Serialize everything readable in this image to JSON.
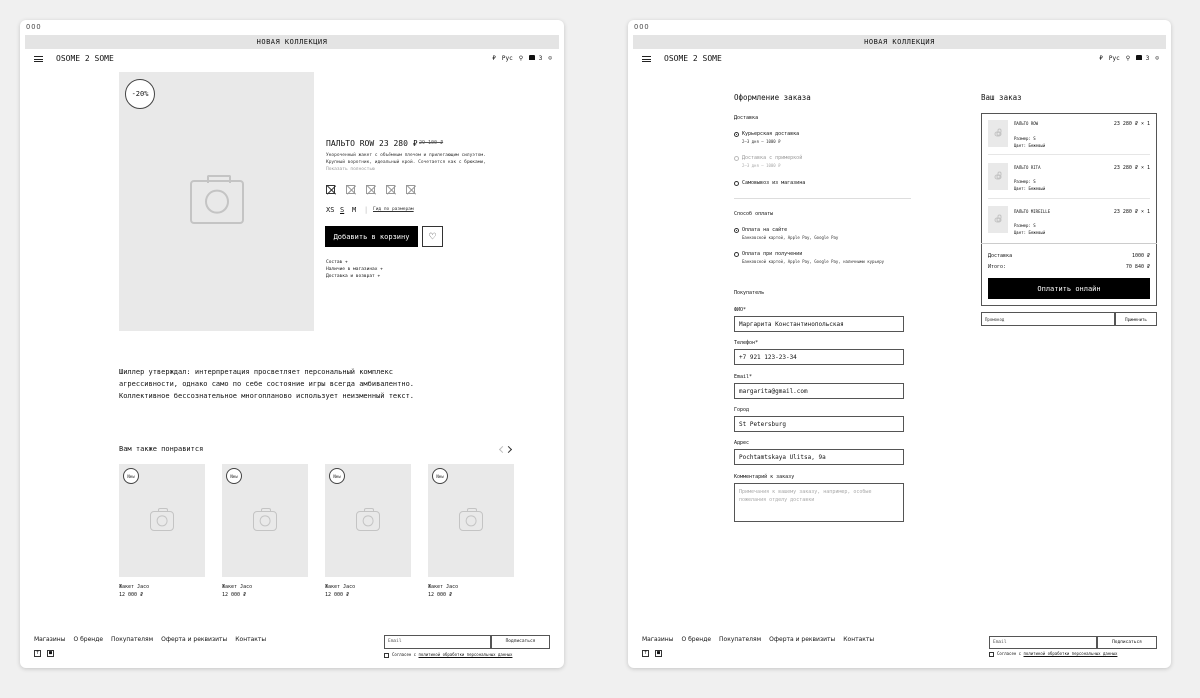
{
  "window_dots": "OOO",
  "promo": "НОВАЯ КОЛЛЕКЦИЯ",
  "logo": "OSOME 2 SOME",
  "header": {
    "currency": "₽",
    "lang": "Рус",
    "cart_count": "3"
  },
  "product": {
    "discount": "-20%",
    "name": "ПАЛЬТО ROW",
    "price": "23 280 ₽",
    "old_price": "29 100 ₽",
    "desc1": "Укороченный жакет с объёмным плечом и прилегающим силуэтом.",
    "desc2": "Крупный воротник, идеальный крой. Сочетается как с брюками,",
    "show_all": "Показать полностью",
    "sizes": [
      "XS",
      "S",
      "M"
    ],
    "size_sep": "|",
    "size_guide": "Гид по размерам",
    "add_to_cart": "Добавить в корзину",
    "details": [
      "Состав +",
      "Наличие в магазинах +",
      "Доставка и возврат +"
    ]
  },
  "quote": [
    "Шиллер утверждал: интерпретация просветляет персональный комплекс",
    "агрессивности, однако само по себе состояние игры всегда амбивалентно.",
    "Коллективное бессознательное многопланово использует неизменный текст."
  ],
  "recommend": {
    "title": "Вам также понравится",
    "items": [
      {
        "badge": "New",
        "name": "Жакет Jaco",
        "price": "12 000 ₽"
      },
      {
        "badge": "New",
        "name": "Жакет Jaco",
        "price": "12 000 ₽"
      },
      {
        "badge": "New",
        "name": "Жакет Jaco",
        "price": "12 000 ₽"
      },
      {
        "badge": "New",
        "name": "Жакет Jaco",
        "price": "12 000 ₽"
      }
    ]
  },
  "footer": {
    "nav": [
      "Магазины",
      "О бренде",
      "Покупателям",
      "Оферта и реквизиты",
      "Контакты"
    ],
    "social": [
      "f",
      "■"
    ],
    "email_placeholder": "Email",
    "subscribe": "Подписаться",
    "consent_prefix": "Согласен с ",
    "consent_link": "политикой обработки персональных данных"
  },
  "checkout": {
    "title": "Оформление заказа",
    "delivery_label": "Доставка",
    "delivery_options": [
      {
        "title": "Курьерская доставка",
        "sub": "2–3 дня — 1000 ₽"
      },
      {
        "title": "Доставка с примеркой",
        "sub": "2–3 дня — 1000 ₽"
      },
      {
        "title": "Самовывоз из магазина",
        "sub": ""
      }
    ],
    "payment_label": "Способ оплаты",
    "payment_options": [
      {
        "title": "Оплата на сайте",
        "sub": "Банковской картой, Apple Pay, Google Pay"
      },
      {
        "title": "Оплата при получении",
        "sub": "Банковской картой, Apple Pay, Google Pay, наличными курьеру"
      }
    ],
    "buyer_label": "Покупатель",
    "fields": [
      {
        "label": "ФИО*",
        "value": "Маргарита Константинопольская"
      },
      {
        "label": "Телефон*",
        "value": "+7 921 123-23-34"
      },
      {
        "label": "Email*",
        "value": "margarita@gmail.com"
      },
      {
        "label": "Город",
        "value": "St Petersburg"
      },
      {
        "label": "Адрес",
        "value": "Pochtamtskaya Ulitsa, 9a"
      }
    ],
    "comment_label": "Комментарий к заказу",
    "comment_placeholder": "Примечания к вашему заказу, например, особые пожелания отделу доставки"
  },
  "order": {
    "title": "Ваш заказ",
    "items": [
      {
        "name": "ПАЛЬТО ROW",
        "size": "Размер: S",
        "color": "Цвет: Бежевый",
        "price": "23 280 ₽ × 1"
      },
      {
        "name": "ПАЛЬТО RITA",
        "size": "Размер: S",
        "color": "Цвет: Бежевый",
        "price": "23 280 ₽ × 1"
      },
      {
        "name": "ПАЛЬТО MIREILLE",
        "size": "Размер: S",
        "color": "Цвет: Бежевый",
        "price": "23 280 ₽ × 1"
      }
    ],
    "delivery_label": "Доставка",
    "delivery_value": "1000 ₽",
    "total_label": "Итого:",
    "total_value": "70 840 ₽",
    "pay_button": "Оплатить онлайн",
    "promo_placeholder": "Промокод",
    "apply": "Применить"
  }
}
